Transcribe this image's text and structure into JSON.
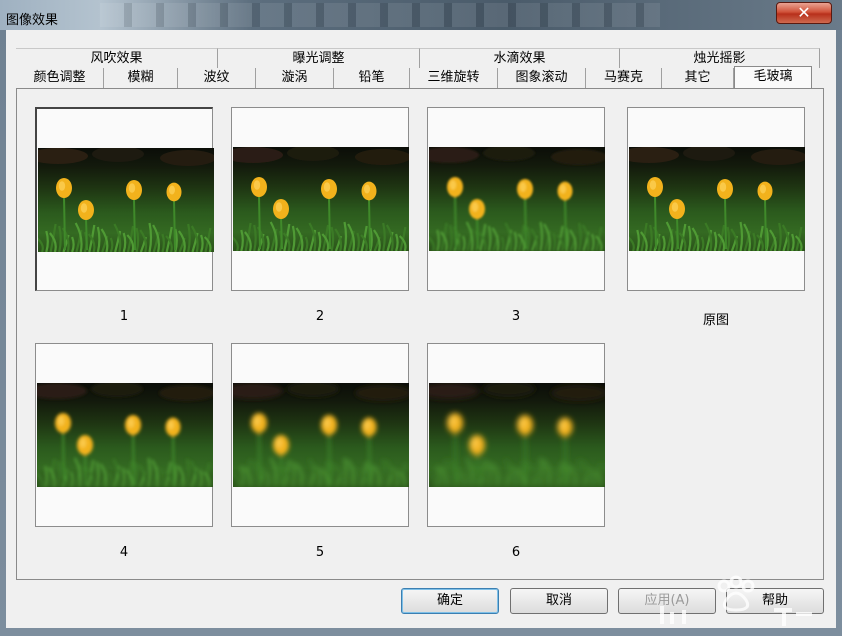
{
  "window": {
    "title": "图像效果",
    "close_glyph": "✕"
  },
  "tabs": {
    "back_row": [
      "风吹效果",
      "曝光调整",
      "水滴效果",
      "烛光摇影"
    ],
    "front_row": [
      "颜色调整",
      "模糊",
      "波纹",
      "漩涡",
      "铅笔",
      "三维旋转",
      "图象滚动",
      "马赛克",
      "其它",
      "毛玻璃"
    ],
    "active": "毛玻璃"
  },
  "thumbnails": [
    {
      "caption": "1",
      "blur": 0.0,
      "selected": true
    },
    {
      "caption": "2",
      "blur": 0.3,
      "selected": false
    },
    {
      "caption": "3",
      "blur": 1.0,
      "selected": false
    },
    {
      "caption": "原图",
      "blur": 0.0,
      "selected": false
    },
    {
      "caption": "4",
      "blur": 1.6,
      "selected": false
    },
    {
      "caption": "5",
      "blur": 2.3,
      "selected": false
    },
    {
      "caption": "6",
      "blur": 2.9,
      "selected": false
    }
  ],
  "buttons": {
    "ok": "确定",
    "cancel": "取消",
    "apply": "应用(A)",
    "help": "帮助"
  },
  "colors": {
    "flower": "#f2b21c",
    "stem": "#3f8a2a",
    "close": "#c8442b"
  },
  "icons": {
    "close": "close-icon",
    "photo": "tulip-photo"
  }
}
